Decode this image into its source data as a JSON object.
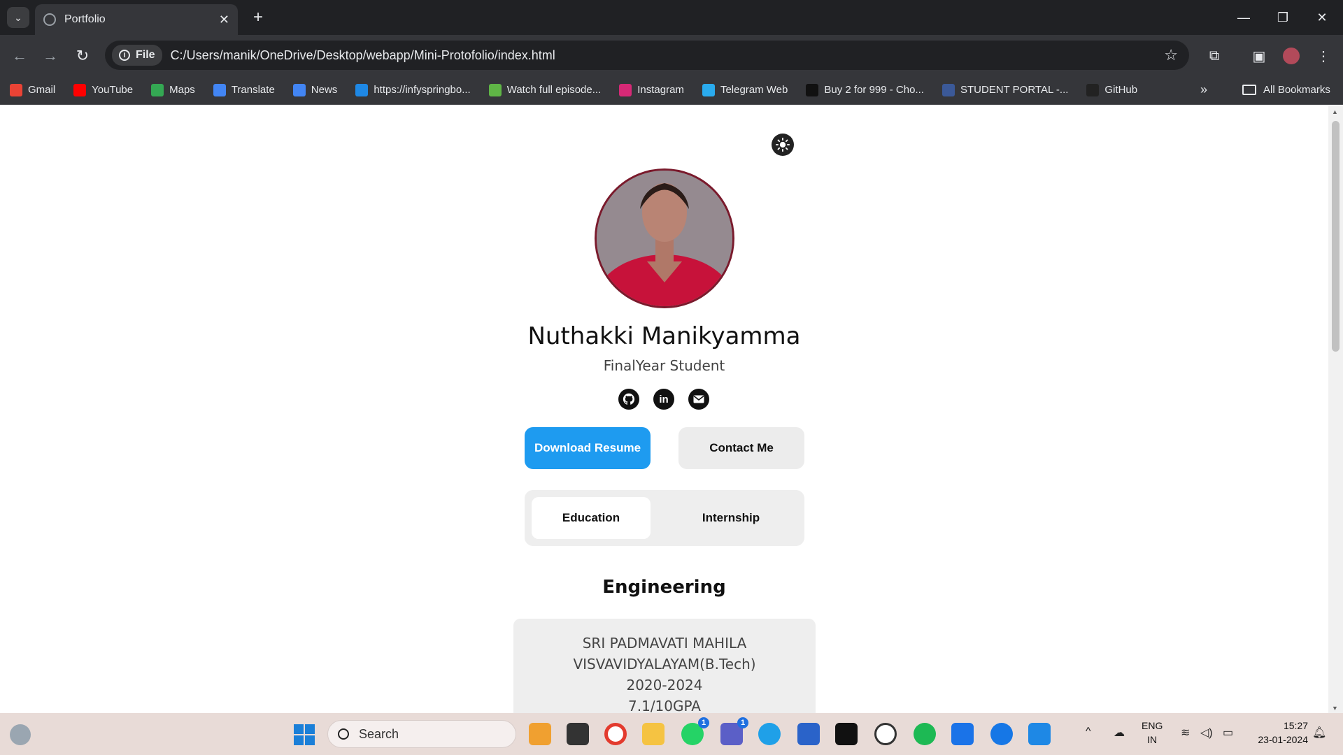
{
  "browser": {
    "tab_title": "Portfolio",
    "file_chip": "File",
    "url": "C:/Users/manik/OneDrive/Desktop/webapp/Mini-Protofolio/index.html",
    "bookmarks": [
      {
        "label": "Gmail",
        "icon": "gmail-icon",
        "color": "#ea4335"
      },
      {
        "label": "YouTube",
        "icon": "youtube-icon",
        "color": "#ff0000"
      },
      {
        "label": "Maps",
        "icon": "maps-icon",
        "color": "#34a853"
      },
      {
        "label": "Translate",
        "icon": "translate-icon",
        "color": "#4285f4"
      },
      {
        "label": "News",
        "icon": "news-icon",
        "color": "#4285f4"
      },
      {
        "label": "https://infyspringbo...",
        "icon": "infosys-icon",
        "color": "#1e88e5"
      },
      {
        "label": "Watch full episode...",
        "icon": "hotstar-icon",
        "color": "#5fb546"
      },
      {
        "label": "Instagram",
        "icon": "instagram-icon",
        "color": "#d62976"
      },
      {
        "label": "Telegram Web",
        "icon": "telegram-icon",
        "color": "#2aabee"
      },
      {
        "label": "Buy 2 for 999 - Cho...",
        "icon": "shop-icon",
        "color": "#111111"
      },
      {
        "label": "STUDENT PORTAL -...",
        "icon": "portal-icon",
        "color": "#3b5998"
      },
      {
        "label": "GitHub",
        "icon": "github-icon",
        "color": "#222222"
      }
    ],
    "all_bookmarks": "All Bookmarks"
  },
  "profile": {
    "name": "Nuthakki Manikyamma",
    "role": "FinalYear Student",
    "download_button": "Download Resume",
    "contact_button": "Contact Me",
    "tab_education": "Education",
    "tab_internship": "Internship",
    "section_title": "Engineering",
    "card_lines": [
      "SRI PADMAVATI MAHILA",
      "VISVAVIDYALAYAM(B.Tech)",
      "2020-2024",
      "7.1/10GPA"
    ]
  },
  "taskbar": {
    "search_placeholder": "Search",
    "lang_top": "ENG",
    "lang_bottom": "IN",
    "time": "15:27",
    "date": "23-01-2024",
    "whatsapp_badge": "1",
    "teams_badge": "1"
  }
}
